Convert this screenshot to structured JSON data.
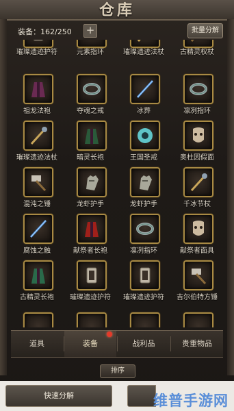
{
  "header": {
    "title": "仓库",
    "capacity": "装备：162/250",
    "add_label": "+",
    "bulk_decompose": "批量分解"
  },
  "items": [
    {
      "name": "璀璨遗迹护符",
      "icon": "amulet-icon"
    },
    {
      "name": "元素指环",
      "icon": "ring-icon"
    },
    {
      "name": "璀璨遗迹法杖",
      "icon": "staff-icon"
    },
    {
      "name": "古精灵权杖",
      "icon": "scepter-icon"
    },
    {
      "name": "祖龙法袍",
      "icon": "robe-icon"
    },
    {
      "name": "夺魂之戒",
      "icon": "ring-icon"
    },
    {
      "name": "冰葬",
      "icon": "wand-icon"
    },
    {
      "name": "凛冽指环",
      "icon": "ring-icon"
    },
    {
      "name": "璀璨遗迹法杖",
      "icon": "staff-icon"
    },
    {
      "name": "暗灵长袍",
      "icon": "robe-icon"
    },
    {
      "name": "王国圣戒",
      "icon": "holy-ring-icon"
    },
    {
      "name": "奥杜因假面",
      "icon": "mask-icon"
    },
    {
      "name": "混沌之锤",
      "icon": "hammer-icon"
    },
    {
      "name": "龙虾护手",
      "icon": "gauntlet-icon"
    },
    {
      "name": "龙虾护手",
      "icon": "gauntlet-icon"
    },
    {
      "name": "千冰节杖",
      "icon": "staff-icon"
    },
    {
      "name": "腐蚀之触",
      "icon": "wand-icon"
    },
    {
      "name": "献祭者长袍",
      "icon": "robe-icon"
    },
    {
      "name": "凛冽指环",
      "icon": "ring-icon"
    },
    {
      "name": "献祭者面具",
      "icon": "mask-icon"
    },
    {
      "name": "古精灵长袍",
      "icon": "robe-icon"
    },
    {
      "name": "璀璨遗迹护符",
      "icon": "amulet-icon"
    },
    {
      "name": "璀璨遗迹护符",
      "icon": "amulet-icon"
    },
    {
      "name": "吉尔伯特方锤",
      "icon": "hammer-icon"
    }
  ],
  "tabs": [
    {
      "label": "道具"
    },
    {
      "label": "装备"
    },
    {
      "label": "战利品"
    },
    {
      "label": "贵重物品"
    }
  ],
  "active_tab": "装备",
  "sort_label": "排序",
  "quick_decompose": "快速分解",
  "watermark": "维普手游网",
  "colors": {
    "slot_border": "#a88a44",
    "notify": "#e43a2a",
    "watermark": "#5b8fd8"
  }
}
